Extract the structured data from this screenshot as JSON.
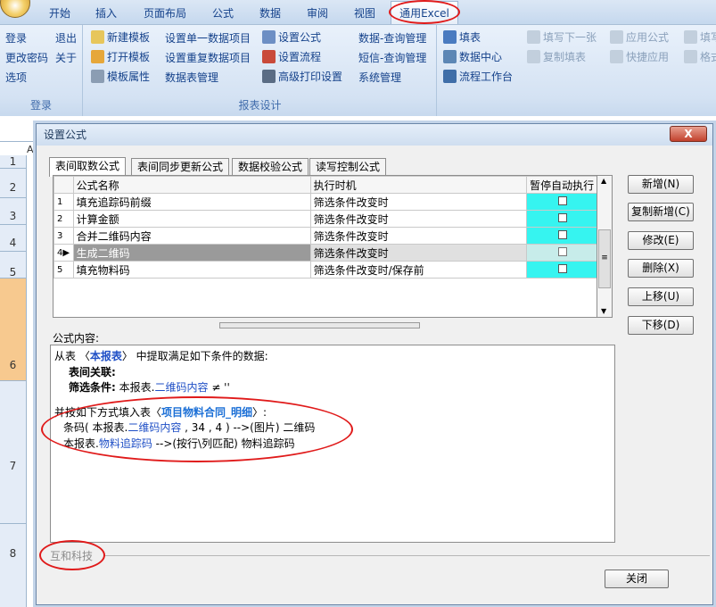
{
  "menubar": {
    "items": [
      "开始",
      "插入",
      "页面布局",
      "公式",
      "数据",
      "审阅",
      "视图"
    ],
    "active": "通用Excel"
  },
  "ribbon": {
    "login_group": {
      "label": "登录",
      "buttons": [
        [
          "登录",
          "退出"
        ],
        [
          "更改密码",
          "关于"
        ],
        [
          "选项"
        ]
      ]
    },
    "design_group": {
      "label": "报表设计",
      "col1": [
        "新建模板",
        "打开模板",
        "模板属性"
      ],
      "col2": [
        "设置单一数据项目",
        "设置重复数据项目",
        "数据表管理"
      ],
      "col3": [
        "设置公式",
        "设置流程",
        "高级打印设置"
      ],
      "col4": [
        "数据-查询管理",
        "短信-查询管理",
        "系统管理"
      ]
    },
    "other": {
      "col1": [
        "填表",
        "数据中心",
        "流程工作台"
      ],
      "col2": [
        "填写下一张",
        "复制填表"
      ],
      "col3": [
        "应用公式",
        "快捷应用"
      ],
      "col4": [
        "填写",
        "格式"
      ]
    }
  },
  "sheet": {
    "col_a": "A",
    "rows": [
      "1",
      "2",
      "3",
      "4",
      "5",
      "6",
      "7",
      "8"
    ]
  },
  "dialog": {
    "title": "设置公式",
    "close": "X",
    "tabs": [
      "表间取数公式",
      "表间同步更新公式",
      "数据校验公式",
      "读写控制公式"
    ],
    "grid": {
      "headers": [
        "公式名称",
        "执行时机",
        "暂停自动执行"
      ],
      "rows": [
        {
          "no": "1",
          "name": "填充追踪码前缀",
          "timing": "筛选条件改变时"
        },
        {
          "no": "2",
          "name": "计算金额",
          "timing": "筛选条件改变时"
        },
        {
          "no": "3",
          "name": "合并二维码内容",
          "timing": "筛选条件改变时"
        },
        {
          "no": "4",
          "name": "生成二维码",
          "timing": "筛选条件改变时"
        },
        {
          "no": "5",
          "name": "填充物料码",
          "timing": "筛选条件改变时/保存前"
        }
      ]
    },
    "buttons": [
      "新增(N)",
      "复制新增(C)",
      "修改(E)",
      "删除(X)",
      "上移(U)",
      "下移(D)"
    ],
    "content_label": "公式内容:",
    "content": {
      "l1a": "从表 〈",
      "l1b": "本报表",
      "l1c": "〉 中提取满足如下条件的数据:",
      "l2": "表间关联:",
      "l3a": "筛选条件:",
      "l3b": "本报表.",
      "l3c": "二维码内容",
      "l3d": "≠ ''",
      "l4a": "并按如下方式填入表〈",
      "l4b": "项目物料合同_明细",
      "l4c": "〉:",
      "l5a": "条码( 本报表.",
      "l5b": "二维码内容",
      "l5c": ", 34 , 4 )  -->(图片) 二维码",
      "l6a": "本报表.",
      "l6b": "物料追踪码",
      "l6c": "  -->(按行\\列匹配) 物料追踪码"
    },
    "footer_brand": "互和科技",
    "close_button": "关闭"
  }
}
